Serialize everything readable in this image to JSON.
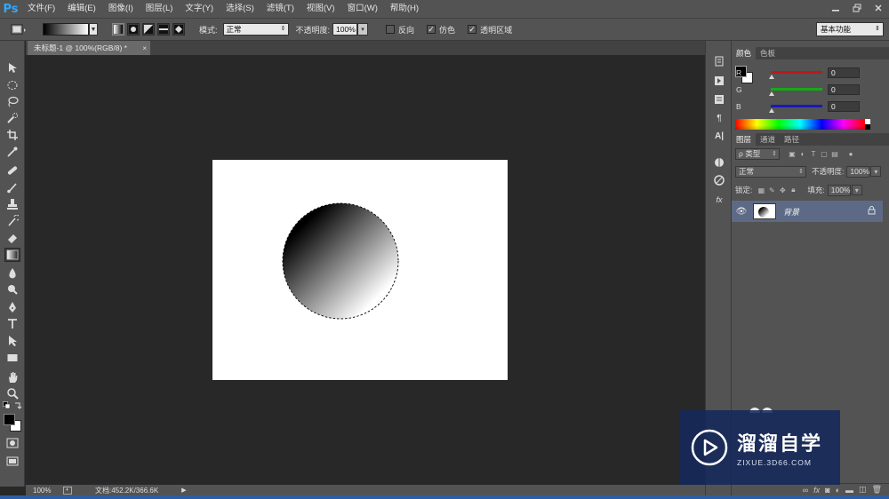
{
  "app": {
    "logo": "Ps",
    "menu": [
      "文件(F)",
      "编辑(E)",
      "图像(I)",
      "图层(L)",
      "文字(Y)",
      "选择(S)",
      "滤镜(T)",
      "视图(V)",
      "窗口(W)",
      "帮助(H)"
    ]
  },
  "options": {
    "mode_label": "模式:",
    "mode_value": "正常",
    "opacity_label": "不透明度:",
    "opacity_value": "100%",
    "reverse_label": "反向",
    "dither_label": "仿色",
    "transparency_label": "透明区域",
    "reverse_checked": false,
    "dither_checked": true,
    "transparency_checked": true,
    "workspace": "基本功能"
  },
  "document": {
    "tab_title": "未标题-1 @ 100%(RGB/8) *",
    "zoom": "100%",
    "doc_size": "文档:452.2K/366.6K"
  },
  "color_panel": {
    "tabs": [
      "颜色",
      "色板"
    ],
    "channels": [
      {
        "label": "R",
        "value": "0",
        "color": "#d02020"
      },
      {
        "label": "G",
        "value": "0",
        "color": "#20b020"
      },
      {
        "label": "B",
        "value": "0",
        "color": "#2020d0"
      }
    ]
  },
  "layers_panel": {
    "tabs": [
      "图层",
      "通道",
      "路径"
    ],
    "filter_label": "ρ 类型",
    "blend_mode": "正常",
    "opacity_label": "不透明度:",
    "opacity_value": "100%",
    "lock_label": "锁定:",
    "fill_label": "填充:",
    "fill_value": "100%",
    "layers": [
      {
        "name": "背景",
        "locked": true,
        "visible": true
      }
    ]
  },
  "watermark": {
    "title": "溜溜自学",
    "url": "ZIXUE.3D66.COM"
  }
}
